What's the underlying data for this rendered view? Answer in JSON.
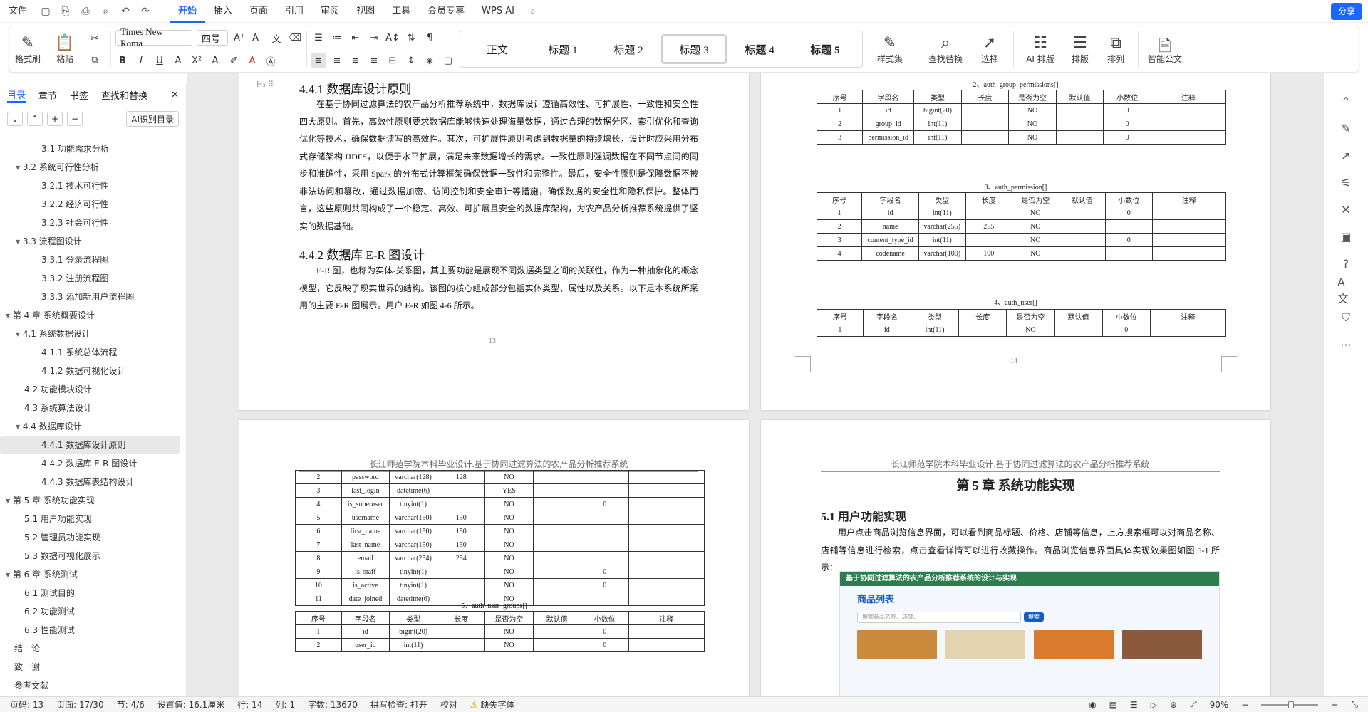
{
  "topbar": {
    "file": "文件",
    "tabs": [
      "开始",
      "插入",
      "页面",
      "引用",
      "审阅",
      "视图",
      "工具",
      "会员专享",
      "WPS AI"
    ],
    "share": "分享"
  },
  "ribbon": {
    "format_painter": "格式刷",
    "paste": "粘贴",
    "font_name": "Times New Roma",
    "font_size": "四号",
    "styles": [
      "正文",
      "标题 1",
      "标题 2",
      "标题 3",
      "标题 4",
      "标题 5"
    ],
    "style_set": "样式集",
    "find_replace": "查找替换",
    "select": "选择",
    "ai_layout": "AI 排版",
    "layout": "排版",
    "arrange": "排列",
    "smart_doc": "智能公文"
  },
  "leftpanel": {
    "tabs": [
      "目录",
      "章节",
      "书签",
      "查找和替换"
    ],
    "ai_toc": "AI识别目录",
    "items": [
      {
        "t": "3.1 功能需求分析",
        "lvl": 2
      },
      {
        "t": "3.2 系统可行性分析",
        "lvl": 1
      },
      {
        "t": "3.2.1 技术可行性",
        "lvl": 2
      },
      {
        "t": "3.2.2 经济可行性",
        "lvl": 2
      },
      {
        "t": "3.2.3 社会可行性",
        "lvl": 2
      },
      {
        "t": "3.3 流程图设计",
        "lvl": 1
      },
      {
        "t": "3.3.1 登录流程图",
        "lvl": 2
      },
      {
        "t": "3.3.2 注册流程图",
        "lvl": 2
      },
      {
        "t": "3.3.3 添加新用户流程图",
        "lvl": 2
      },
      {
        "t": "第 4 章 系统概要设计",
        "lvl": 0
      },
      {
        "t": "4.1 系统数据设计",
        "lvl": 1
      },
      {
        "t": "4.1.1 系统总体流程",
        "lvl": 2
      },
      {
        "t": "4.1.2 数据可视化设计",
        "lvl": 2
      },
      {
        "t": "4.2 功能模块设计",
        "lvl": 1
      },
      {
        "t": "4.3 系统算法设计",
        "lvl": 1
      },
      {
        "t": "4.4 数据库设计",
        "lvl": 1
      },
      {
        "t": "4.4.1 数据库设计原则",
        "lvl": 2,
        "sel": true
      },
      {
        "t": "4.4.2 数据库 E-R 图设计",
        "lvl": 2
      },
      {
        "t": "4.4.3 数据库表结构设计",
        "lvl": 2
      },
      {
        "t": "第 5 章 系统功能实现",
        "lvl": 0
      },
      {
        "t": "5.1 用户功能实现",
        "lvl": 1
      },
      {
        "t": "5.2 管理员功能实现",
        "lvl": 1
      },
      {
        "t": "5.3 数据可视化展示",
        "lvl": 1
      },
      {
        "t": "第 6 章 系统测试",
        "lvl": 0
      },
      {
        "t": "6.1 测试目的",
        "lvl": 1
      },
      {
        "t": "6.2 功能测试",
        "lvl": 1
      },
      {
        "t": "6.3 性能测试",
        "lvl": 1
      },
      {
        "t": "结　论",
        "lvl": 0
      },
      {
        "t": "致　谢",
        "lvl": 0
      },
      {
        "t": "参考文献",
        "lvl": 0
      }
    ]
  },
  "page13": {
    "h1": "4.4.1 数据库设计原则",
    "p1": "在基于协同过滤算法的农产品分析推荐系统中，数据库设计遵循高效性、可扩展性、一致性和安全性四大原则。首先，高效性原则要求数据库能够快速处理海量数据，通过合理的数据分区、索引优化和查询优化等技术，确保数据读写的高效性。其次，可扩展性原则考虑到数据量的持续增长，设计时应采用分布式存储架构 HDFS，以便于水平扩展，满足未来数据增长的需求。一致性原则强调数据在不同节点间的同步和准确性，采用 Spark 的分布式计算框架确保数据一致性和完整性。最后，安全性原则是保障数据不被非法访问和篡改，通过数据加密、访问控制和安全审计等措施，确保数据的安全性和隐私保护。整体而言，这些原则共同构成了一个稳定、高效、可扩展且安全的数据库架构，为农产品分析推荐系统提供了坚实的数据基础。",
    "h2": "4.4.2 数据库 E-R 图设计",
    "p2": "E-R 图，也称为实体-关系图，其主要功能是展现不同数据类型之间的关联性，作为一种抽象化的概念模型，它反映了现实世界的结构。该图的核心组成部分包括实体类型、属性以及关系。以下是本系统所采用的主要 E-R 图展示。用户 E-R 如图 4-6 所示。",
    "num": "13"
  },
  "page14": {
    "t2": "2、auth_group_permissions[]",
    "t3": "3、auth_permission[]",
    "t4": "4、auth_user[]",
    "num": "14",
    "head": [
      "序号",
      "字段名",
      "类型",
      "长度",
      "是否为空",
      "默认值",
      "小数位",
      "注释"
    ],
    "rows2": [
      [
        "1",
        "id",
        "bigint(20)",
        "",
        "NO",
        "",
        "0",
        ""
      ],
      [
        "2",
        "group_id",
        "int(11)",
        "",
        "NO",
        "",
        "0",
        ""
      ],
      [
        "3",
        "permission_id",
        "int(11)",
        "",
        "NO",
        "",
        "0",
        ""
      ]
    ],
    "rows3": [
      [
        "1",
        "id",
        "int(11)",
        "",
        "NO",
        "",
        "0",
        ""
      ],
      [
        "2",
        "name",
        "varchar(255)",
        "255",
        "NO",
        "",
        "",
        ""
      ],
      [
        "3",
        "content_type_id",
        "int(11)",
        "",
        "NO",
        "",
        "0",
        ""
      ],
      [
        "4",
        "codename",
        "varchar(100)",
        "100",
        "NO",
        "",
        "",
        ""
      ]
    ],
    "rows4": [
      [
        "1",
        "id",
        "int(11)",
        "",
        "NO",
        "",
        "0",
        ""
      ]
    ]
  },
  "page15": {
    "header": "长江师范学院本科毕业设计.基于协同过滤算法的农产品分析推荐系统",
    "t5": "5、auth_user_groups[]",
    "rows": [
      [
        "2",
        "password",
        "varchar(128)",
        "128",
        "NO",
        "",
        "",
        ""
      ],
      [
        "3",
        "last_login",
        "datetime(6)",
        "",
        "YES",
        "",
        "",
        ""
      ],
      [
        "4",
        "is_superuser",
        "tinyint(1)",
        "",
        "NO",
        "",
        "0",
        ""
      ],
      [
        "5",
        "username",
        "varchar(150)",
        "150",
        "NO",
        "",
        "",
        ""
      ],
      [
        "6",
        "first_name",
        "varchar(150)",
        "150",
        "NO",
        "",
        "",
        ""
      ],
      [
        "7",
        "last_name",
        "varchar(150)",
        "150",
        "NO",
        "",
        "",
        ""
      ],
      [
        "8",
        "email",
        "varchar(254)",
        "254",
        "NO",
        "",
        "",
        ""
      ],
      [
        "9",
        "is_staff",
        "tinyint(1)",
        "",
        "NO",
        "",
        "0",
        ""
      ],
      [
        "10",
        "is_active",
        "tinyint(1)",
        "",
        "NO",
        "",
        "0",
        ""
      ],
      [
        "11",
        "date_joined",
        "datetime(6)",
        "",
        "NO",
        "",
        "",
        ""
      ]
    ],
    "rows5": [
      [
        "1",
        "id",
        "bigint(20)",
        "",
        "NO",
        "",
        "0",
        ""
      ],
      [
        "2",
        "user_id",
        "int(11)",
        "",
        "NO",
        "",
        "0",
        ""
      ]
    ]
  },
  "page16": {
    "header": "长江师范学院本科毕业设计.基于协同过滤算法的农产品分析推荐系统",
    "chapter": "第 5 章 系统功能实现",
    "sec": "5.1 用户功能实现",
    "p": "用户点击商品浏览信息界面，可以看到商品标题、价格、店铺等信息，上方搜索框可以对商品名称、店铺等信息进行检索，点击查看详情可以进行收藏操作。商品浏览信息界面具体实现效果图如图 5-1 所示：",
    "shot_title": "基于协同过滤算法的农产品分析推荐系统的设计与实现",
    "shot_list": "商品列表",
    "shot_search": "搜索商品名称、店铺...",
    "shot_btn": "搜索"
  },
  "statusbar": {
    "page": "页码: 13",
    "pages": "页面: 17/30",
    "section": "节: 4/6",
    "setting": "设置值: 16.1厘米",
    "row": "行: 14",
    "col": "列: 1",
    "words": "字数: 13670",
    "spell": "拼写检查: 打开",
    "proof": "校对",
    "missing": "缺失字体",
    "zoom": "90%"
  },
  "colors": {
    "accent": "#1a66ff"
  }
}
